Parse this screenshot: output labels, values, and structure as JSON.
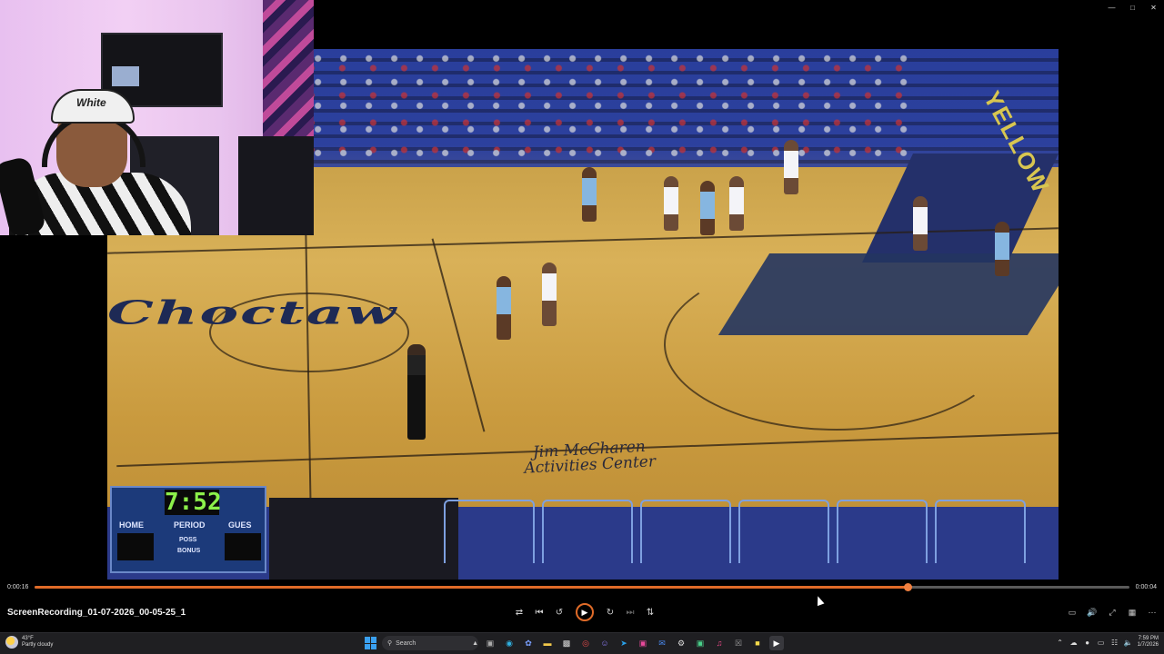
{
  "window": {
    "minimize_icon": "minimize-icon",
    "maximize_icon": "maximize-icon",
    "close_icon": "close-icon"
  },
  "video": {
    "court_text": "Choctaw",
    "floor_text_line1": "Jim McCharen",
    "floor_text_line2": "Activities Center",
    "baseline_text": "YELLOW"
  },
  "scoreboard": {
    "clock": "7:52",
    "home_label": "HOME",
    "period_label": "PERIOD",
    "guest_label": "GUES",
    "poss_label": "POSS",
    "bonus_label": "BONUS"
  },
  "webcam": {
    "cap_text": "White"
  },
  "playback": {
    "current_time": "0:00:16",
    "total_time": "0:00:04",
    "progress_fraction": 0.797,
    "accent_color": "#e06b28"
  },
  "player": {
    "file_name": "ScreenRecording_01-07-2026_00-05-25_1",
    "controls": [
      "shuffle-icon",
      "previous-icon",
      "rewind-10-icon",
      "play-icon",
      "forward-30-icon",
      "next-icon",
      "repeat-icon"
    ],
    "right_controls": [
      "miniplayer-icon",
      "volume-icon",
      "fullscreen-icon",
      "aspect-icon",
      "more-icon"
    ]
  },
  "taskbar": {
    "weather_temp": "43°F",
    "weather_desc": "Partly cloudy",
    "search_placeholder": "Search",
    "time": "7:59 PM",
    "date": "1/7/2026"
  }
}
